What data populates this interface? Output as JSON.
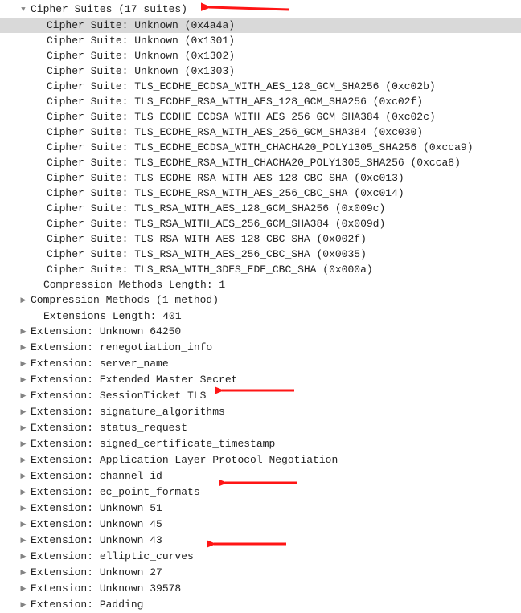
{
  "cipherSuitesHeader": "Cipher Suites (17 suites)",
  "cipherSuites": [
    {
      "label": "Cipher Suite:",
      "value": "Unknown (0x4a4a)"
    },
    {
      "label": "Cipher Suite:",
      "value": "Unknown (0x1301)"
    },
    {
      "label": "Cipher Suite:",
      "value": "Unknown (0x1302)"
    },
    {
      "label": "Cipher Suite:",
      "value": "Unknown (0x1303)"
    },
    {
      "label": "Cipher Suite:",
      "value": "TLS_ECDHE_ECDSA_WITH_AES_128_GCM_SHA256 (0xc02b)"
    },
    {
      "label": "Cipher Suite:",
      "value": "TLS_ECDHE_RSA_WITH_AES_128_GCM_SHA256 (0xc02f)"
    },
    {
      "label": "Cipher Suite:",
      "value": "TLS_ECDHE_ECDSA_WITH_AES_256_GCM_SHA384 (0xc02c)"
    },
    {
      "label": "Cipher Suite:",
      "value": "TLS_ECDHE_RSA_WITH_AES_256_GCM_SHA384 (0xc030)"
    },
    {
      "label": "Cipher Suite:",
      "value": "TLS_ECDHE_ECDSA_WITH_CHACHA20_POLY1305_SHA256 (0xcca9)"
    },
    {
      "label": "Cipher Suite:",
      "value": "TLS_ECDHE_RSA_WITH_CHACHA20_POLY1305_SHA256 (0xcca8)"
    },
    {
      "label": "Cipher Suite:",
      "value": "TLS_ECDHE_RSA_WITH_AES_128_CBC_SHA (0xc013)"
    },
    {
      "label": "Cipher Suite:",
      "value": "TLS_ECDHE_RSA_WITH_AES_256_CBC_SHA (0xc014)"
    },
    {
      "label": "Cipher Suite:",
      "value": "TLS_RSA_WITH_AES_128_GCM_SHA256 (0x009c)"
    },
    {
      "label": "Cipher Suite:",
      "value": "TLS_RSA_WITH_AES_256_GCM_SHA384 (0x009d)"
    },
    {
      "label": "Cipher Suite:",
      "value": "TLS_RSA_WITH_AES_128_CBC_SHA (0x002f)"
    },
    {
      "label": "Cipher Suite:",
      "value": "TLS_RSA_WITH_AES_256_CBC_SHA (0x0035)"
    },
    {
      "label": "Cipher Suite:",
      "value": "TLS_RSA_WITH_3DES_EDE_CBC_SHA (0x000a)"
    }
  ],
  "compressionLength": "Compression Methods Length: 1",
  "compressionMethods": "Compression Methods (1 method)",
  "extensionsLength": "Extensions Length: 401",
  "extensions": [
    {
      "text": "Extension: Unknown 64250"
    },
    {
      "text": "Extension: renegotiation_info"
    },
    {
      "text": "Extension: server_name"
    },
    {
      "text": "Extension: Extended Master Secret"
    },
    {
      "text": "Extension: SessionTicket TLS"
    },
    {
      "text": "Extension: signature_algorithms"
    },
    {
      "text": "Extension: status_request"
    },
    {
      "text": "Extension: signed_certificate_timestamp"
    },
    {
      "text": "Extension: Application Layer Protocol Negotiation"
    },
    {
      "text": "Extension: channel_id"
    },
    {
      "text": "Extension: ec_point_formats"
    },
    {
      "text": "Extension: Unknown 51"
    },
    {
      "text": "Extension: Unknown 45"
    },
    {
      "text": "Extension: Unknown 43"
    },
    {
      "text": "Extension: elliptic_curves"
    },
    {
      "text": "Extension: Unknown 27"
    },
    {
      "text": "Extension: Unknown 39578"
    },
    {
      "text": "Extension: Padding"
    }
  ]
}
